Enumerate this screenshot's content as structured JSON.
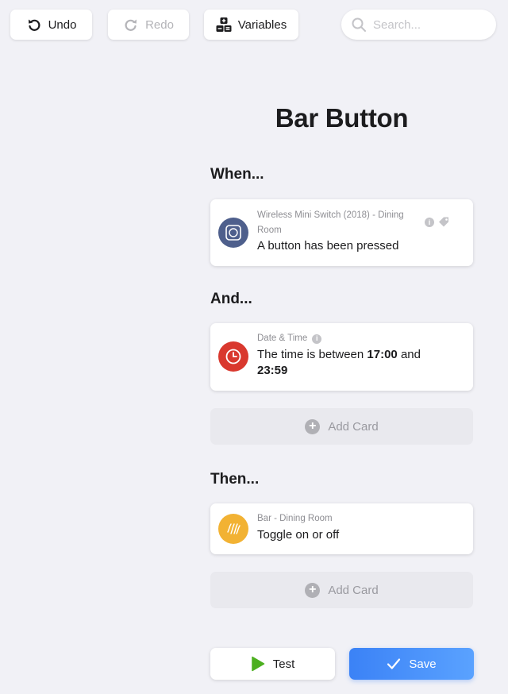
{
  "toolbar": {
    "undo_label": "Undo",
    "redo_label": "Redo",
    "variables_label": "Variables"
  },
  "search": {
    "placeholder": "Search...",
    "value": ""
  },
  "flow": {
    "title": "Bar Button",
    "when": {
      "heading": "When...",
      "card": {
        "device": "Wireless Mini Switch (2018) - Dining",
        "device_line2": "Room",
        "text": "A button has been pressed",
        "icon": "button-device-icon",
        "color": "#4e5f8c"
      }
    },
    "and": {
      "heading": "And...",
      "card": {
        "source": "Date & Time",
        "text_prefix": "The time is between ",
        "time_start": "17:00",
        "text_mid": " and",
        "time_end": "23:59",
        "icon": "clock-icon",
        "color": "#d9382e"
      },
      "add_card_label": "Add Card"
    },
    "then": {
      "heading": "Then...",
      "card": {
        "device": "Bar - Dining Room",
        "text": "Toggle on or off",
        "icon": "light-strip-icon",
        "color": "#f2b233"
      },
      "add_card_label": "Add Card"
    }
  },
  "actions": {
    "test_label": "Test",
    "save_label": "Save",
    "test_color": "#4caf1f",
    "save_color": "#3b82f6"
  }
}
